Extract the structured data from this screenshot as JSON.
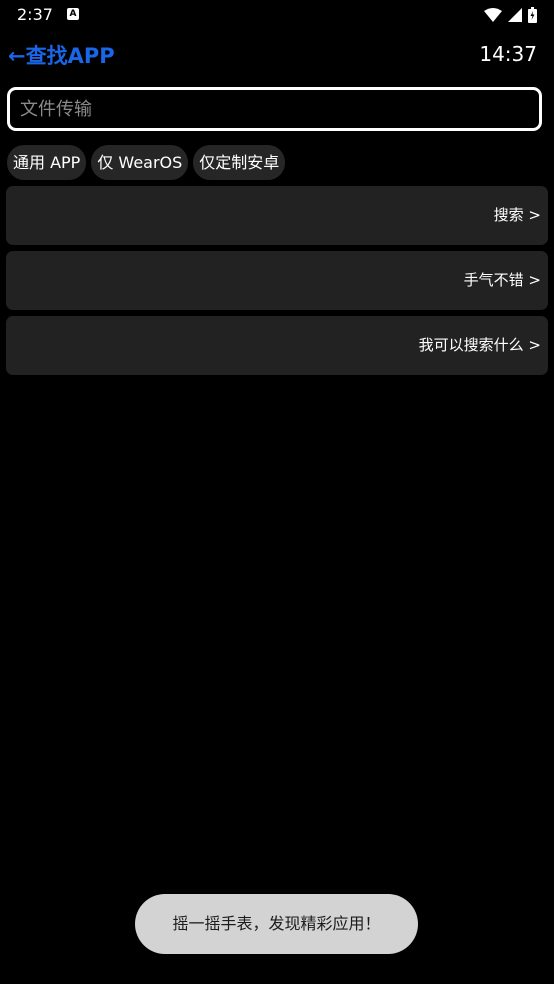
{
  "status_bar": {
    "time": "2:37",
    "notification_icon": "A"
  },
  "header": {
    "title": "←查找APP",
    "clock": "14:37"
  },
  "search": {
    "placeholder": "文件传输"
  },
  "chips": [
    {
      "label": "通用 APP"
    },
    {
      "label": "仅 WearOS"
    },
    {
      "label": "仅定制安卓"
    }
  ],
  "cards": [
    {
      "label": "搜索 >"
    },
    {
      "label": "手气不错 >"
    },
    {
      "label": "我可以搜索什么 >"
    }
  ],
  "toast": {
    "message": "摇一摇手表，发现精彩应用！"
  },
  "colors": {
    "accent": "#1a66e8",
    "background": "#000000",
    "card": "#222222",
    "chip": "#262626",
    "toast": "#d3d3d3"
  }
}
